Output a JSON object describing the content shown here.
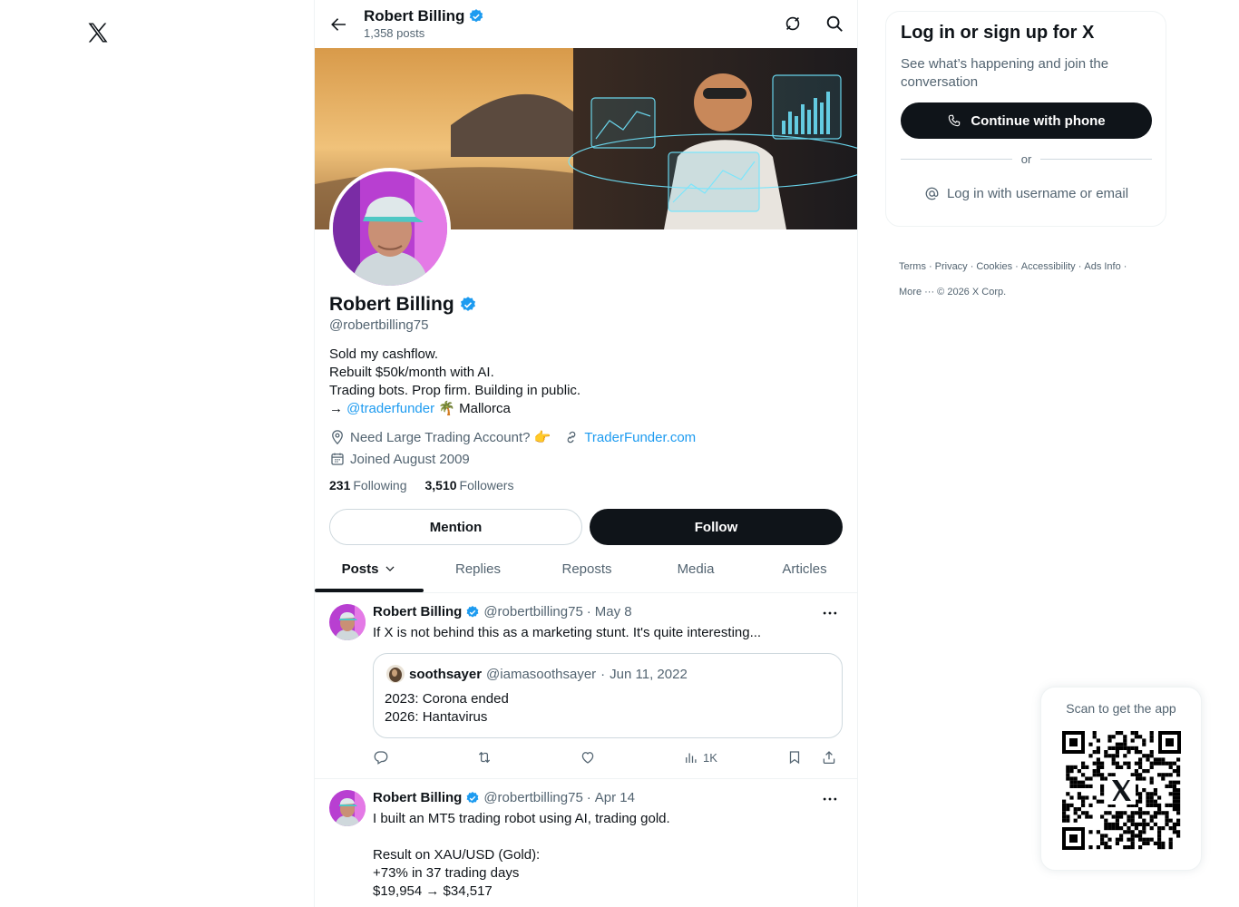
{
  "profile": {
    "name": "Robert Billing",
    "posts_count": "1,358 posts",
    "handle": "@robertbilling75",
    "bio_lines": [
      "Sold my cashflow.",
      "Rebuilt $50k/month with AI.",
      "Trading bots. Prop firm. Building in public."
    ],
    "bio_arrow": "→",
    "bio_mention": "@traderfunder",
    "bio_location": "🌴 Mallorca",
    "location": "Need Large Trading Account? 👉",
    "website": "TraderFunder.com",
    "joined": "Joined August 2009",
    "following_count": "231",
    "following_label": "Following",
    "followers_count": "3,510",
    "followers_label": "Followers",
    "mention_label": "Mention",
    "follow_label": "Follow"
  },
  "tabs": [
    {
      "label": "Posts",
      "active": true
    },
    {
      "label": "Replies"
    },
    {
      "label": "Reposts"
    },
    {
      "label": "Media"
    },
    {
      "label": "Articles"
    }
  ],
  "tweets": [
    {
      "name": "Robert Billing",
      "handle": "@robertbilling75",
      "date": "May 8",
      "text": "If X is not behind this as a marketing stunt. It's quite interesting...",
      "quote": {
        "name": "soothsayer",
        "handle": "@iamasoothsayer",
        "date": "Jun 11, 2022",
        "text": "2023: Corona ended\n2026: Hantavirus"
      },
      "views": "1K"
    },
    {
      "name": "Robert Billing",
      "handle": "@robertbilling75",
      "date": "Apr 14",
      "text": "I built an MT5 trading robot using AI, trading gold.\n\nResult on XAU/USD (Gold):\n+73% in 37 trading days\n$19,954 → $34,517"
    }
  ],
  "login": {
    "title": "Log in or sign up for X",
    "subtitle": "See what’s happening and join the conversation",
    "phone_button": "Continue with phone",
    "or": "or",
    "user_button": "Log in with username or email"
  },
  "footer": {
    "links": [
      "Terms",
      "Privacy",
      "Cookies",
      "Accessibility",
      "Ads Info",
      "More ···"
    ],
    "copyright": "© 2026 X Corp."
  },
  "qr": {
    "title": "Scan to get the app"
  },
  "colors": {
    "accent": "#1d9bf0",
    "text": "#0f1419",
    "muted": "#536471",
    "border": "#eff3f4"
  }
}
